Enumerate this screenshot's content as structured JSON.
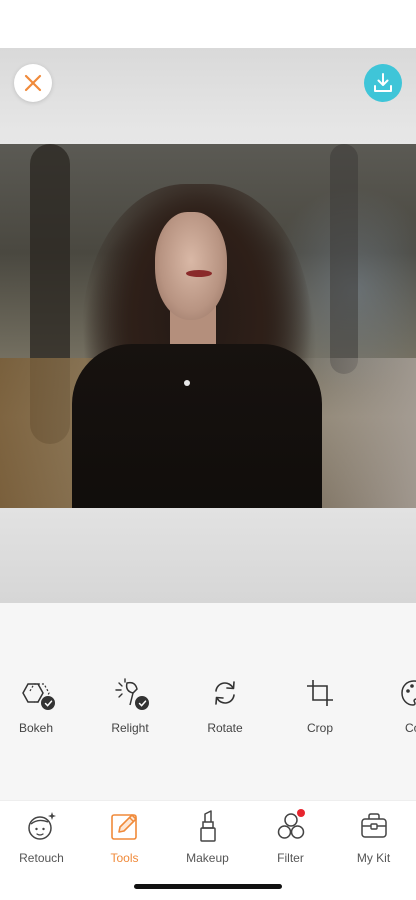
{
  "topbar": {
    "close_icon": "close-x-icon",
    "download_icon": "download-icon",
    "close_color": "#f08a3a",
    "download_color": "#3fc5d8"
  },
  "tools": [
    {
      "label": "Bokeh",
      "icon": "bokeh-hexagon-icon",
      "checked": true
    },
    {
      "label": "Relight",
      "icon": "relight-lamp-icon",
      "checked": true
    },
    {
      "label": "Rotate",
      "icon": "rotate-arrows-icon",
      "checked": false
    },
    {
      "label": "Crop",
      "icon": "crop-icon",
      "checked": false
    },
    {
      "label": "Col",
      "icon": "color-palette-icon",
      "checked": false
    }
  ],
  "nav": [
    {
      "label": "Retouch",
      "icon": "retouch-face-icon",
      "active": false
    },
    {
      "label": "Tools",
      "icon": "tools-pencil-icon",
      "active": true
    },
    {
      "label": "Makeup",
      "icon": "makeup-lipstick-icon",
      "active": false
    },
    {
      "label": "Filter",
      "icon": "filter-circles-icon",
      "active": false,
      "badge": true
    },
    {
      "label": "My Kit",
      "icon": "my-kit-bag-icon",
      "active": false
    }
  ],
  "colors": {
    "accent": "#f08a3a",
    "notification": "#e8252e"
  }
}
